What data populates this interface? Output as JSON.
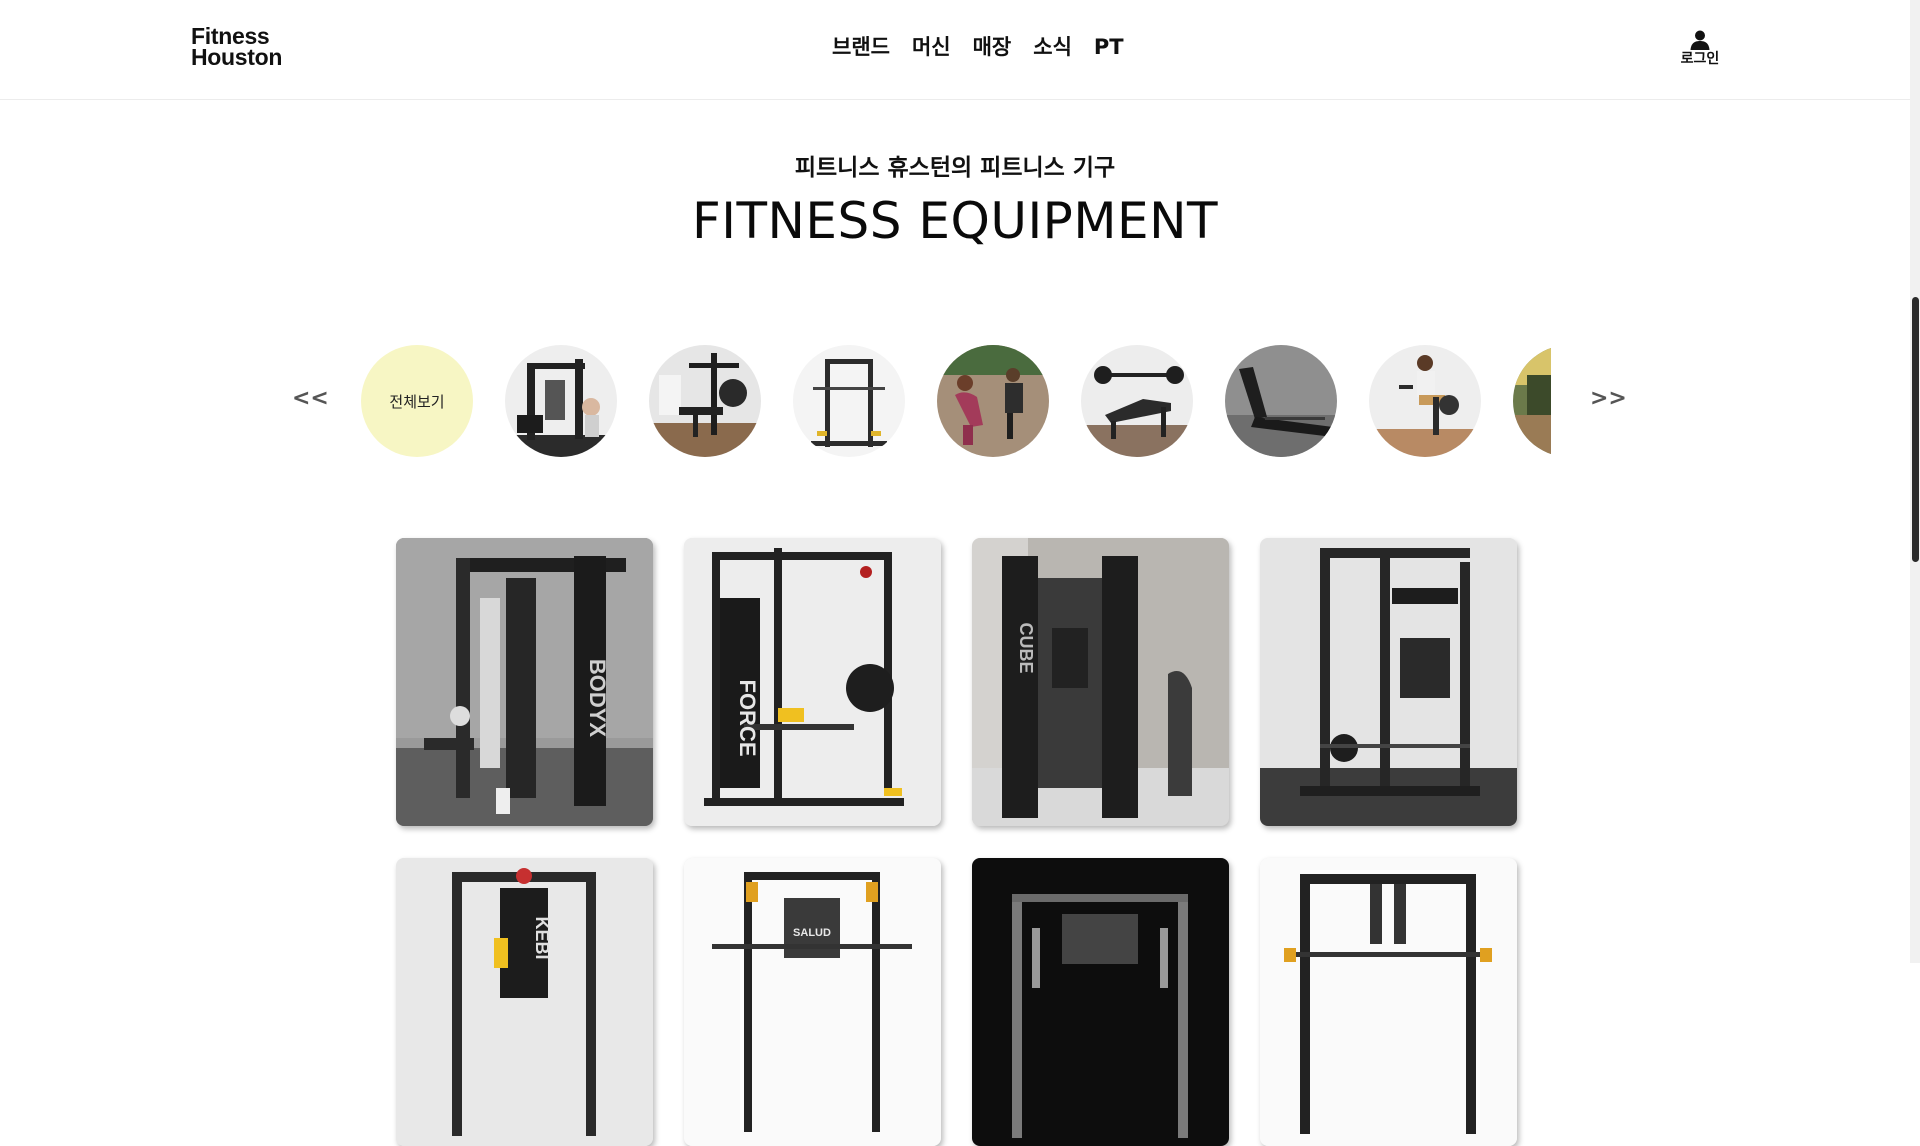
{
  "header": {
    "logo_line1": "Fitness",
    "logo_line2": "Houston",
    "nav": [
      "브랜드",
      "머신",
      "매장",
      "소식",
      "PT"
    ],
    "login_label": "로그인"
  },
  "hero": {
    "subtitle": "피트니스 휴스턴의 피트니스 기구",
    "title": "FITNESS EQUIPMENT"
  },
  "categories": {
    "prev_label": "<<",
    "next_label": ">>",
    "all_label": "전체보기",
    "all_color": "#f7f6c4"
  },
  "products": [
    {
      "brand_mark": "BODYX"
    },
    {
      "brand_mark": "FORCE"
    },
    {
      "brand_mark": "CUBE"
    },
    {
      "brand_mark": ""
    },
    {
      "brand_mark": "KEBI"
    },
    {
      "brand_mark": "SALUD"
    },
    {
      "brand_mark": ""
    },
    {
      "brand_mark": ""
    }
  ],
  "colors": {
    "text": "#111111",
    "accent_yellow": "#f7f6c4",
    "scrollbar_thumb": "#2a2a2a"
  }
}
